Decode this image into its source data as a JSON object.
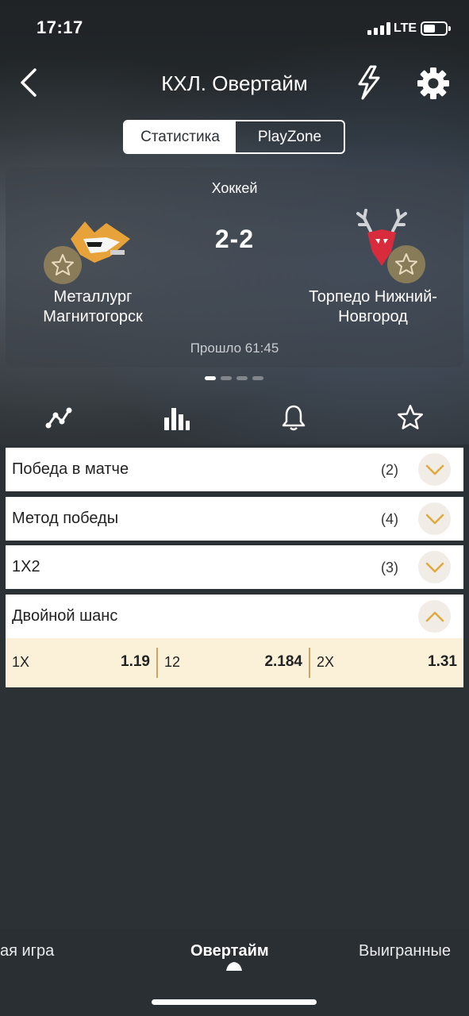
{
  "status_bar": {
    "time": "17:17",
    "network": "LTE"
  },
  "header": {
    "title": "КХЛ. Овертайм"
  },
  "segments": {
    "stats": "Статистика",
    "playzone": "PlayZone"
  },
  "match": {
    "sport": "Хоккей",
    "score": "2-2",
    "home_team_line1": "Металлург",
    "home_team_line2": "Магнитогорск",
    "away_team_line1": "Торпедо Нижний-",
    "away_team_line2": "Новгород",
    "elapsed": "Прошло 61:45"
  },
  "markets": [
    {
      "title": "Победа в матче",
      "count": "(2)"
    },
    {
      "title": "Метод победы",
      "count": "(4)"
    },
    {
      "title": "1X2",
      "count": "(3)"
    },
    {
      "title": "Двойной шанс"
    }
  ],
  "double_chance": [
    {
      "label": "1X",
      "value": "1.19"
    },
    {
      "label": "12",
      "value": "2.184"
    },
    {
      "label": "2X",
      "value": "1.31"
    }
  ],
  "bottom_tabs": {
    "left": "ая игра",
    "center": "Овертайм",
    "right": "Выигранные"
  },
  "colors": {
    "accent": "#e0a93b",
    "odds_bg": "#fbf0d8",
    "background": "#2c3135"
  }
}
